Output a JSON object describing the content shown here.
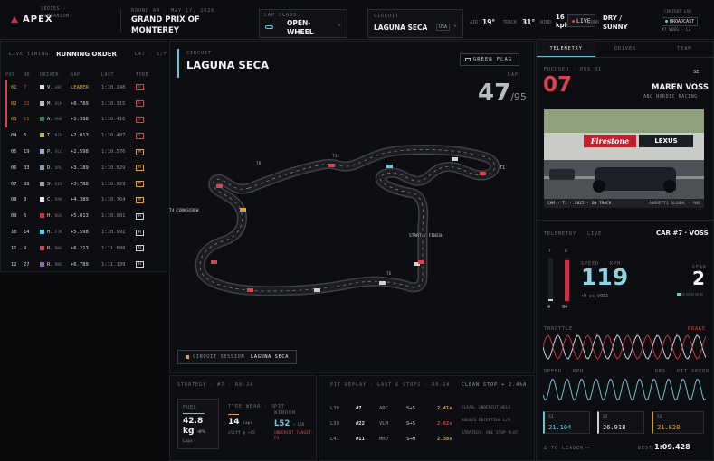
{
  "header": {
    "brand": "APEX",
    "brand_sub": "SERIES · COMPANION",
    "round": "ROUND 04 · MAY 17, 2026",
    "event": "GRAND PRIX OF MONTEREY",
    "lap_class_label": "LAP CLASS",
    "lap_class": "OPEN-WHEEL",
    "circuit_label": "CIRCUIT",
    "circuit": "LAGUNA SECA",
    "country": "USA",
    "air_label": "AIR",
    "air": "19°",
    "track_label": "TRACK",
    "track": "31°",
    "wind_label": "WIND",
    "wind": "16 kph",
    "live_label": "LIVE",
    "cond_label": "COND",
    "cond": "DRY / SUNNY",
    "contents_label": "CONTENT LAB",
    "broadcast": "BROADCAST",
    "broadcast_sub": "#7 VOSS · L3"
  },
  "running_order": {
    "live_timing": "LIVE TIMING",
    "title": "RUNNING ORDER",
    "lap_info": "L47 · S/F",
    "columns": [
      "POS",
      "NO",
      "DRIVER",
      "GAP",
      "LAST",
      "TYRE"
    ],
    "rows": [
      {
        "pos": "01",
        "no": "7",
        "drv": "V.",
        "code": "ABC",
        "gap": "LEADER",
        "last": "1:10.248",
        "tyre": "S",
        "sw": "#e0e0e0",
        "hl": true
      },
      {
        "pos": "02",
        "no": "22",
        "drv": "M.",
        "code": "VLM",
        "gap": "+0.789",
        "last": "1:10.315",
        "tyre": "S",
        "sw": "#bdbdbd",
        "hl": true
      },
      {
        "pos": "03",
        "no": "11",
        "drv": "A.",
        "code": "MHD",
        "gap": "+1.398",
        "last": "1:10.416",
        "tyre": "S",
        "sw": "#3b7a5a",
        "hl": true
      },
      {
        "pos": "04",
        "no": "6",
        "drv": "T.",
        "code": "NIN",
        "gap": "+2.013",
        "last": "1:10.487",
        "tyre": "S",
        "sw": "#c9b24a",
        "hl": false
      },
      {
        "pos": "05",
        "no": "19",
        "drv": "P.",
        "code": "VLO",
        "gap": "+2.598",
        "last": "1:10.576",
        "tyre": "M",
        "sw": "#a0a8c8",
        "hl": false
      },
      {
        "pos": "06",
        "no": "33",
        "drv": "D.",
        "code": "ORL",
        "gap": "+3.189",
        "last": "1:10.629",
        "tyre": "M",
        "sw": "#8c9bb4",
        "hl": false
      },
      {
        "pos": "07",
        "no": "88",
        "drv": "S.",
        "code": "RIS",
        "gap": "+3.788",
        "last": "1:10.629",
        "tyre": "M",
        "sw": "#9aa0a6",
        "hl": false
      },
      {
        "pos": "08",
        "no": "3",
        "drv": "C.",
        "code": "PAK",
        "gap": "+4.389",
        "last": "1:10.764",
        "tyre": "M",
        "sw": "#e6e6e6",
        "hl": false
      },
      {
        "pos": "09",
        "no": "6",
        "drv": "H.",
        "code": "NUS",
        "gap": "+5.013",
        "last": "1:10.981",
        "tyre": "H",
        "sw": "#c1354a",
        "hl": false
      },
      {
        "pos": "10",
        "no": "14",
        "drv": "H.",
        "code": "FJK",
        "gap": "+5.598",
        "last": "1:10.992",
        "tyre": "H",
        "sw": "#6ec4d6",
        "hl": false
      },
      {
        "pos": "11",
        "no": "9",
        "drv": "R.",
        "code": "RNG",
        "gap": "+6.213",
        "last": "1:11.088",
        "tyre": "H",
        "sw": "#b5565f",
        "hl": false
      },
      {
        "pos": "12",
        "no": "27",
        "drv": "R.",
        "code": "RNG",
        "gap": "+6.789",
        "last": "1:11.139",
        "tyre": "H",
        "sw": "#8a6e9e",
        "hl": false
      }
    ]
  },
  "map": {
    "label": "CIRCUIT",
    "title": "LAGUNA SECA",
    "flag": "GREEN FLAG",
    "lap_label": "LAP",
    "lap": "47",
    "lap_total": "/95",
    "session_label": "CIRCUIT SESSION",
    "session_val": "LAGUNA SECA",
    "corners": [
      "T1",
      "T4 CORKSCREW",
      "T8",
      "START / FINISH",
      "T11",
      "T6"
    ]
  },
  "strategy": {
    "title": "STRATEGY · #7 · R8-2A",
    "fuel_label": "FUEL",
    "fuel": "42.8",
    "fuel_unit": "kg",
    "fuel_delta": "-0%",
    "fuel_laps": "Laps",
    "tyre_label": "TYRE WEAR · S",
    "tyre": "14",
    "tyre_unit": "laps",
    "tyre_sub": "cliff @ ~45",
    "pit_label": "PIT WINDOW",
    "pit": "L52",
    "pit_unit": "→ L58",
    "pit_sub": "UNDERCUT TARGET: P3"
  },
  "pit_replay": {
    "title": "PIT REPLAY · LAST 6 STOPS · R8-2A",
    "rows": [
      {
        "lap": "L38",
        "no": "#7",
        "team": "ABC",
        "tyre": "S→S",
        "time": "2.41s",
        "col": "#d9a441"
      },
      {
        "lap": "L39",
        "no": "#22",
        "team": "VLM",
        "tyre": "S→S",
        "time": "2.62s",
        "col": "#d8434f"
      },
      {
        "lap": "L41",
        "no": "#11",
        "team": "MHD",
        "tyre": "S→M",
        "time": "2.38s",
        "col": "#d9a441"
      }
    ],
    "note_title": "CLEAN STOP + 2.4%a",
    "notes": [
      "CLEAN, UNDERCUT HELD",
      "RADIUS RECEPTION L/R",
      "STRATEGY: ONE STOP PLOT"
    ]
  },
  "tabs": [
    "TELEMETRY",
    "DRIVER",
    "TEAM"
  ],
  "focused": {
    "label": "FOCUSED · POS 01",
    "code": "SE",
    "number": "07",
    "name": "MAREN VOSS",
    "team": "ABC NORDIC RACING",
    "cam_caption": "CAM · T1 · 2025 · ON TRACK",
    "cam_caption2": "ANDRETTI GLOBAL · M46",
    "cam_sponsor1": "Firestone",
    "cam_sponsor2": "LEXUS"
  },
  "telemetry": {
    "label": "TELEMETRY · LIVE",
    "car": "CAR #7 · VOSS",
    "bar_labels": [
      "T",
      "B"
    ],
    "bar_vals": [
      "4",
      "94"
    ],
    "throttle": 4,
    "brake": 94,
    "speed_label": "SPEED · KPH",
    "speed": "119",
    "speed_sub": "+0 vs VOSS",
    "gear_label": "GEAR",
    "gear": "2",
    "throttle_label": "THROTTLE",
    "brake_label": "BRAKE",
    "speed2_label": "SPEED · KPH",
    "speed2_r": "DRS · PIT SPEED",
    "s1_label": "S1",
    "s1": "21.104",
    "s2_label": "S2",
    "s2": "26.918",
    "s3_label": "S3",
    "s3": "21.828",
    "leader_label": "Δ TO LEADER",
    "leader": "—",
    "best_label": "BEST",
    "best": "1:09.428"
  },
  "colors": {
    "accent": "#6ec4d6",
    "red": "#d8434f",
    "amber": "#d9a441"
  }
}
